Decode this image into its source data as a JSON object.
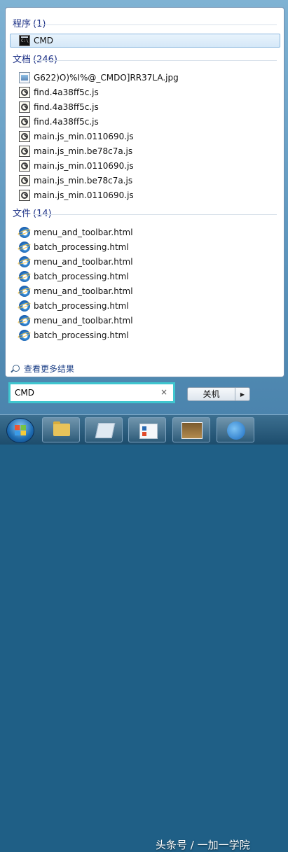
{
  "sections": {
    "programs": {
      "title": "程序",
      "count": "(1)",
      "items": [
        {
          "label": "CMD",
          "icon": "cmd-icon",
          "selected": true
        }
      ]
    },
    "documents": {
      "title": "文档",
      "count": "(246)",
      "items": [
        {
          "label": "G622)O)%I%@_CMDO]RR37LA.jpg",
          "icon": "image-file-icon"
        },
        {
          "label": "find.4a38ff5c.js",
          "icon": "script-file-icon"
        },
        {
          "label": "find.4a38ff5c.js",
          "icon": "script-file-icon"
        },
        {
          "label": "find.4a38ff5c.js",
          "icon": "script-file-icon"
        },
        {
          "label": "main.js_min.0110690.js",
          "icon": "script-file-icon"
        },
        {
          "label": "main.js_min.be78c7a.js",
          "icon": "script-file-icon"
        },
        {
          "label": "main.js_min.0110690.js",
          "icon": "script-file-icon"
        },
        {
          "label": "main.js_min.be78c7a.js",
          "icon": "script-file-icon"
        },
        {
          "label": "main.js_min.0110690.js",
          "icon": "script-file-icon"
        }
      ]
    },
    "files": {
      "title": "文件",
      "count": "(14)",
      "items": [
        {
          "label": "menu_and_toolbar.html",
          "icon": "ie-html-icon"
        },
        {
          "label": "batch_processing.html",
          "icon": "ie-html-icon"
        },
        {
          "label": "menu_and_toolbar.html",
          "icon": "ie-html-icon"
        },
        {
          "label": "batch_processing.html",
          "icon": "ie-html-icon"
        },
        {
          "label": "menu_and_toolbar.html",
          "icon": "ie-html-icon"
        },
        {
          "label": "batch_processing.html",
          "icon": "ie-html-icon"
        },
        {
          "label": "menu_and_toolbar.html",
          "icon": "ie-html-icon"
        },
        {
          "label": "batch_processing.html",
          "icon": "ie-html-icon"
        }
      ]
    }
  },
  "see_more": {
    "label": "查看更多结果",
    "icon": "search-icon"
  },
  "search": {
    "value": "CMD",
    "clear": "×"
  },
  "shutdown": {
    "label": "关机",
    "arrow": "▶"
  },
  "watermark": "头条号 / 一加一学院",
  "colors": {
    "search_highlight": "#3fc6cf",
    "header_text": "#1e3287"
  }
}
